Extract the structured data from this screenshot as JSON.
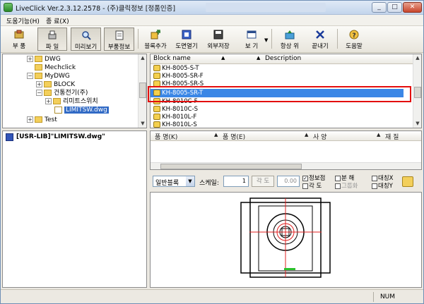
{
  "window": {
    "title": "LiveClick Ver.2.3.12.2578 - (주)클릭정보 [정품인증]",
    "controls": {
      "minimize": "_",
      "restore": "□",
      "close": "✕"
    }
  },
  "menu": [
    "도움기능(H)",
    "종 료(X)"
  ],
  "toolbar": [
    {
      "label": "부 품",
      "icon": "parts-icon"
    },
    {
      "label": "파 일",
      "icon": "file-icon"
    },
    {
      "label": "미리보기",
      "icon": "preview-icon"
    },
    {
      "label": "부품정보",
      "icon": "part-info-icon"
    },
    {
      "label": "블록추가",
      "icon": "add-block-icon"
    },
    {
      "label": "도면열기",
      "icon": "open-drawing-icon"
    },
    {
      "label": "외부저장",
      "icon": "export-icon"
    },
    {
      "label": "보 기",
      "icon": "view-icon"
    },
    {
      "label": "항상 위",
      "icon": "always-top-icon"
    },
    {
      "label": "끝내기",
      "icon": "exit-icon"
    },
    {
      "label": "도움말",
      "icon": "help-icon"
    }
  ],
  "tree": [
    {
      "label": "DWG",
      "expander": "+"
    },
    {
      "label": "Mechclick",
      "expander": ""
    },
    {
      "label": "MyDWG",
      "expander": "−"
    },
    {
      "label": "BLOCK",
      "expander": "+"
    },
    {
      "label": "건통전기(주)",
      "expander": "−"
    },
    {
      "label": "리미트스위치",
      "expander": "+"
    },
    {
      "label": "LIMITSW.dwg",
      "expander": ""
    },
    {
      "label": "Test",
      "expander": "+"
    }
  ],
  "path": "[USR-LIB]\"LIMITSW.dwg\"",
  "block_list": {
    "headers": {
      "name": "Block name",
      "desc": "Description",
      "sort": "▲"
    },
    "rows": [
      "KH-8005-S-T",
      "KH-8005-SR-F",
      "KH-8005-SR-S",
      "KH-8005-SR-T",
      "KH-8010C-F",
      "KH-8010C-S",
      "KH-8010L-F",
      "KH-8010L-S"
    ],
    "selected": "KH-8005-SR-T"
  },
  "attr_grid": {
    "headers": [
      "품 명(K)",
      "품 명(E)",
      "사 양",
      "재 질"
    ],
    "sort": "▲"
  },
  "preview_controls": {
    "layout": "일반블록",
    "scale_label": "스케일:",
    "scale_value": "1",
    "angle_button": "각 도",
    "angle_value": "0.00",
    "checks": [
      {
        "label": "정보점",
        "checked": true
      },
      {
        "label": "각 도",
        "checked": false
      },
      {
        "label": "분 해",
        "checked": false
      },
      {
        "label": "그룹화",
        "checked": false
      },
      {
        "label": "대칭X",
        "checked": false
      },
      {
        "label": "대칭Y",
        "checked": false
      }
    ]
  },
  "status": {
    "mode": "NUM"
  }
}
